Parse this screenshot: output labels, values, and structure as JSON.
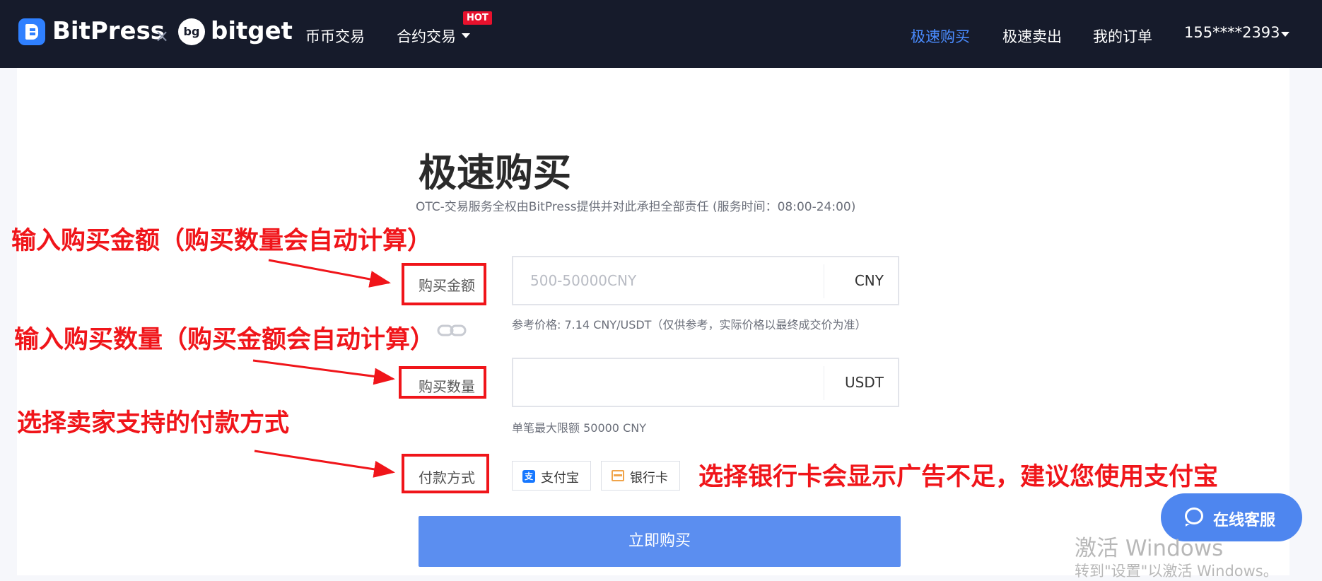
{
  "header": {
    "brand_primary": "BitPress",
    "brand_separator": "×",
    "brand_partner_icon": "bg",
    "brand_partner": "bitget",
    "nav_left": [
      "币币交易",
      "合约交易"
    ],
    "hot_badge": "HOT",
    "nav_right": [
      "极速购买",
      "极速卖出",
      "我的订单"
    ],
    "user": "155****2393",
    "active_color": "#4a8cff"
  },
  "page": {
    "title": "极速购买",
    "subtitle": "OTC-交易服务全权由BitPress提供并对此承担全部责任 (服务时间：08:00-24:00)"
  },
  "form": {
    "amount": {
      "label": "购买金额",
      "placeholder": "500-50000CNY",
      "unit": "CNY"
    },
    "reference_price": "参考价格: 7.14 CNY/USDT（仅供参考，实际价格以最终成交价为准）",
    "quantity": {
      "label": "购买数量",
      "placeholder": "",
      "unit": "USDT"
    },
    "limit_hint": "单笔最大限额 50000 CNY",
    "payment": {
      "label": "付款方式",
      "alipay_icon_glyph": "支",
      "options": [
        "支付宝",
        "银行卡"
      ]
    },
    "submit_label": "立即购买"
  },
  "annotations": [
    "输入购买金额（购买数量会自动计算）",
    "输入购买数量（购买金额会自动计算）",
    "选择卖家支持的付款方式",
    "选择银行卡会显示广告不足，建议您使用支付宝"
  ],
  "support": {
    "label": "在线客服"
  },
  "watermark": {
    "line1": "激活 Windows",
    "line2": "转到\"设置\"以激活 Windows。"
  },
  "colors": {
    "accent": "#5b8ef0",
    "annotation": "#f0151a",
    "header_bg": "#161b2b"
  }
}
